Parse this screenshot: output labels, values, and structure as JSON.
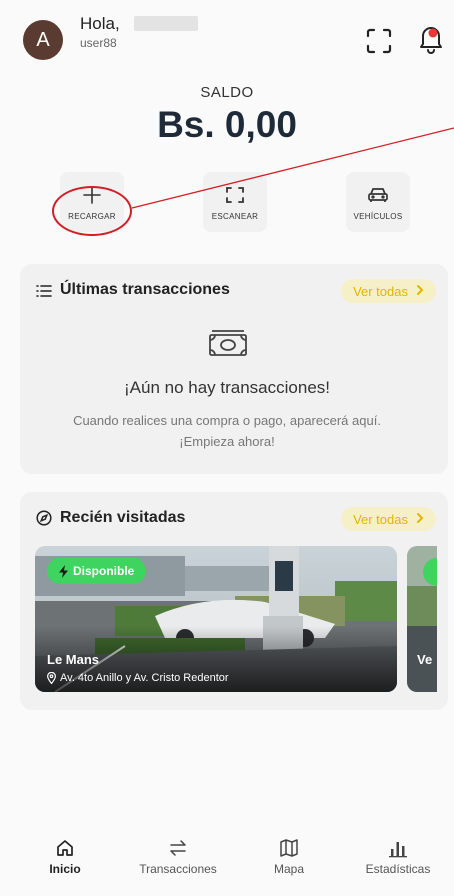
{
  "header": {
    "avatar_initial": "A",
    "greeting": "Hola,",
    "username": "user88"
  },
  "balance": {
    "label": "SALDO",
    "value": "Bs. 0,00"
  },
  "actions": [
    {
      "label": "RECARGAR",
      "icon": "plus-icon"
    },
    {
      "label": "ESCANEAR",
      "icon": "scan-icon"
    },
    {
      "label": "VEHÍCULOS",
      "icon": "car-icon"
    }
  ],
  "transactions": {
    "title": "Últimas transacciones",
    "see_all": "Ver todas",
    "empty_title": "¡Aún no hay transacciones!",
    "empty_line1": "Cuando realices una compra o pago, aparecerá aquí.",
    "empty_line2": "¡Empieza ahora!"
  },
  "recent": {
    "title": "Recién visitadas",
    "see_all": "Ver todas",
    "stations": [
      {
        "status": "Disponible",
        "name": "Le Mans",
        "address": "Av. 4to Anillo y Av. Cristo Redentor"
      },
      {
        "name": "Ve"
      }
    ]
  },
  "tabs": [
    {
      "label": "Inicio",
      "icon": "home-icon",
      "active": true
    },
    {
      "label": "Transacciones",
      "icon": "transfer-icon",
      "active": false
    },
    {
      "label": "Mapa",
      "icon": "map-icon",
      "active": false
    },
    {
      "label": "Estadísticas",
      "icon": "stats-icon",
      "active": false
    }
  ],
  "colors": {
    "accent": "#E3B400",
    "available": "#3FD35F",
    "annotation": "#D21F26",
    "bell_dot": "#E53935"
  }
}
